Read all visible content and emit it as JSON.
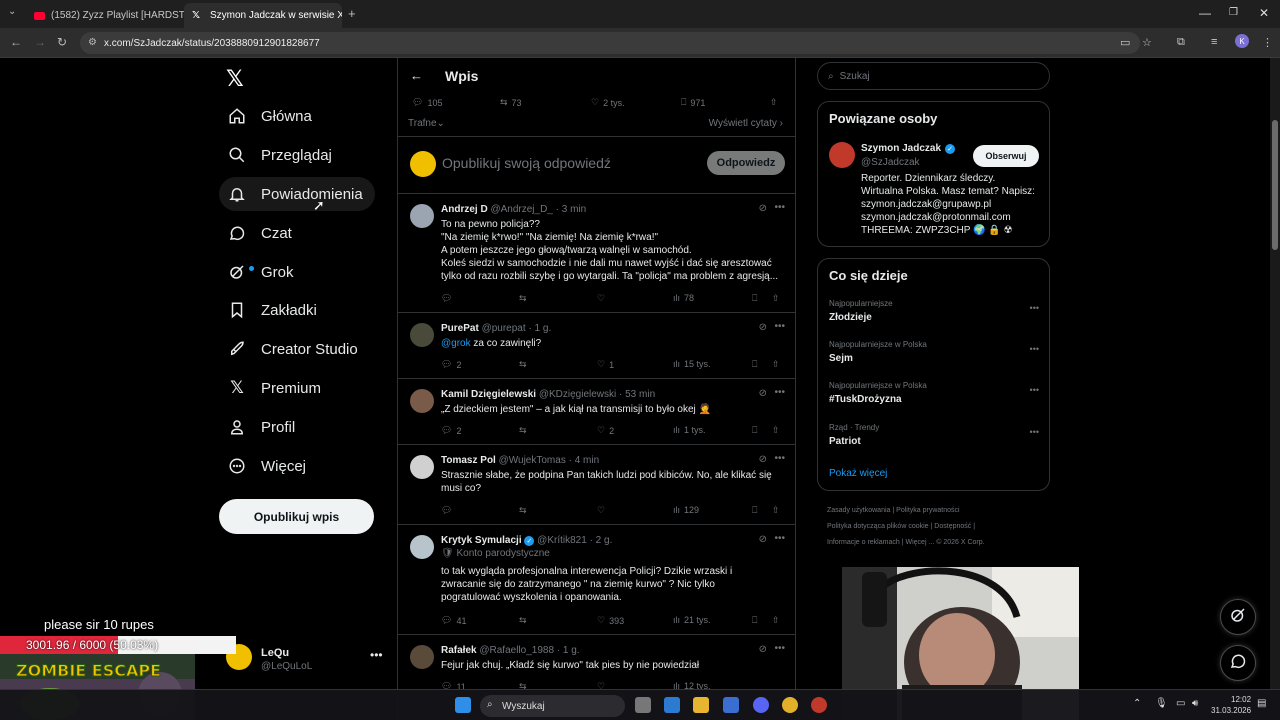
{
  "browser": {
    "tabs": [
      {
        "title": "(1582) Zyzz Playlist [HARDSTYL",
        "icon": "youtube-icon"
      },
      {
        "title": "Szymon Jadczak w serwisie X: ..",
        "icon": "x-logo-icon"
      }
    ],
    "url": "x.com/SzJadczak/status/2038880912901828677",
    "profile_initial": "K"
  },
  "nav": {
    "items": [
      {
        "label": "Główna",
        "icon": "home-icon"
      },
      {
        "label": "Przeglądaj",
        "icon": "search-icon"
      },
      {
        "label": "Powiadomienia",
        "icon": "bell-icon"
      },
      {
        "label": "Czat",
        "icon": "chat-icon"
      },
      {
        "label": "Grok",
        "icon": "grok-icon"
      },
      {
        "label": "Zakładki",
        "icon": "bookmark-icon"
      },
      {
        "label": "Creator Studio",
        "icon": "rocket-icon"
      },
      {
        "label": "Premium",
        "icon": "x-logo-icon"
      },
      {
        "label": "Profil",
        "icon": "person-icon"
      },
      {
        "label": "Więcej",
        "icon": "more-circle-icon"
      }
    ],
    "post_button": "Opublikuj wpis",
    "account": {
      "name": "LeQu",
      "handle": "@LeQuLoL"
    }
  },
  "header": {
    "title": "Wpis"
  },
  "post_stats": {
    "replies": "105",
    "reposts": "73",
    "likes": "2 tys.",
    "bookmarks": "971"
  },
  "sort": {
    "label": "Trafne",
    "quotes": "Wyświetl cytaty"
  },
  "reply_box": {
    "placeholder": "Opublikuj swoją odpowiedź",
    "button": "Odpowiedz"
  },
  "tweets": [
    {
      "name": "Andrzej D",
      "handle": "@Andrzej_D_",
      "time": "· 3 min",
      "lines": [
        "To na pewno policja??",
        "\"Na ziemię k*rwo!\" \"Na ziemię! Na ziemię k*rwa!\"",
        "A potem jeszcze jego głową/twarzą walnęli w samochód.",
        "Koleś siedzi w samochodzie i nie dali mu nawet wyjść i dać się aresztować",
        "tylko od razu rozbili szybę i go wytargali. Ta \"policja\" ma problem z agresją..."
      ],
      "replies": "",
      "reposts": "",
      "likes": "",
      "views": "78"
    },
    {
      "name": "PurePat",
      "handle": "@purepat",
      "time": "· 1 g.",
      "mention": "@grok",
      "text": " za co zawinęli?",
      "replies": "2",
      "reposts": "",
      "likes": "1",
      "views": "15 tys."
    },
    {
      "name": "Kamil Dzięgielewski",
      "handle": "@KDzięgielewski",
      "time": "· 53 min",
      "text": "„Z dzieckiem jestem\" – a jak kiął na transmisji to było okej 🤦",
      "replies": "2",
      "reposts": "",
      "likes": "2",
      "views": "1 tys."
    },
    {
      "name": "Tomasz Pol",
      "handle": "@WujekTomas",
      "time": "· 4 min",
      "lines": [
        "Strasznie słabe, że podpina Pan takich ludzi pod kibiców. No, ale klikać się",
        "musi co?"
      ],
      "replies": "",
      "reposts": "",
      "likes": "",
      "views": "129"
    },
    {
      "name": "Krytyk Symulacji",
      "handle": "@Krítik821",
      "time": "· 2 g.",
      "sub": "🛡 Konto parodystyczne",
      "lines": [
        "to tak wygląda profesjonalna interewencja Policji? Dzikie wrzaski i",
        "zwracanie się do zatrzymanego \" na ziemię kurwo\" ?   Nic tylko",
        "pogratulować wyszkolenia i opanowania."
      ],
      "replies": "41",
      "reposts": "",
      "likes": "393",
      "views": "21 tys."
    },
    {
      "name": "Rafałek",
      "handle": "@Rafaello_1988",
      "time": "· 1 g.",
      "text": "Fejur jak chuj. „Kładź się kurwo\" tak pies by nie powiedział",
      "replies": "11",
      "reposts": "",
      "likes": "",
      "views": "12 tys."
    }
  ],
  "search": {
    "placeholder": "Szukaj"
  },
  "related": {
    "title": "Powiązane osoby",
    "name": "Szymon Jadczak",
    "handle": "@SzJadczak",
    "follow": "Obserwuj",
    "bio": [
      "Reporter. Dziennikarz śledczy.",
      "Wirtualna Polska. Masz temat? Napisz:",
      "szymon.jadczak@grupawp.pl",
      "szymon.jadczak@protonmail.com",
      "THREEMA: ZWPZ3CHP 🌍 🔒 ☢"
    ]
  },
  "trends": {
    "title": "Co się dzieje",
    "items": [
      {
        "meta": "Najpopularniejsze",
        "name": "Złodzieje"
      },
      {
        "meta": "Najpopularniejsze w Polska",
        "name": "Sejm"
      },
      {
        "meta": "Najpopularniejsze w Polska",
        "name": "#TuskDrożyzna"
      },
      {
        "meta": "Rząd · Trendy",
        "name": "Patriot"
      }
    ],
    "show_more": "Pokaż więcej"
  },
  "footer": [
    "Zasady użytkowania",
    "|",
    "Polityka prywatności",
    "|",
    "Polityka dotycząca plików cookie",
    "|",
    "Dostępność",
    "|",
    "Informacje o reklamach",
    "|",
    "Więcej ...",
    "© 2026 X Corp."
  ],
  "stream": {
    "message": "please sir 10 rupes",
    "goal": "3001.96 / 6000 (50.03%)",
    "goal_fraction": 0.5003
  },
  "taskbar": {
    "search": "Wyszukaj",
    "time": "12:02",
    "date": "31.03.2026"
  },
  "colors": {
    "accent": "#1d9bf0",
    "bg": "#000000",
    "border": "#2f3336",
    "muted": "#71767b",
    "goal_red": "#e0263b"
  }
}
